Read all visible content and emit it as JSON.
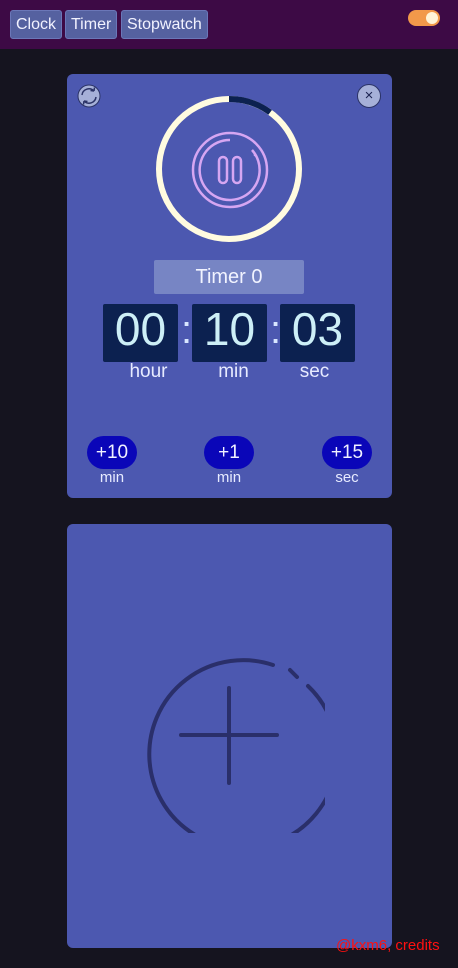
{
  "nav": {
    "clock": "Clock",
    "timer": "Timer",
    "stopwatch": "Stopwatch"
  },
  "theme_toggle": {
    "state": "on",
    "color": "#f2994a"
  },
  "timer_card": {
    "name": "Timer 0",
    "time": {
      "hours": "00",
      "minutes": "10",
      "seconds": "03"
    },
    "separator": ":",
    "units": {
      "hour": "hour",
      "min": "min",
      "sec": "sec"
    },
    "progress_fraction": 0.1,
    "close_label": "×",
    "quick_add": [
      {
        "label": "+10",
        "unit": "min"
      },
      {
        "label": "+1",
        "unit": "min"
      },
      {
        "label": "+15",
        "unit": "sec"
      }
    ]
  },
  "add_timer_card": {
    "icon": "plus-icon"
  },
  "credit": "@kxm6, credits",
  "colors": {
    "topbar": "#3d0a45",
    "card": "#4c58b0",
    "digit_bg": "#0c2150",
    "add_button": "#0a06b8",
    "progress_ring": "#fffbe0",
    "progress_track": "#0c2150",
    "credit": "#ff1010"
  }
}
